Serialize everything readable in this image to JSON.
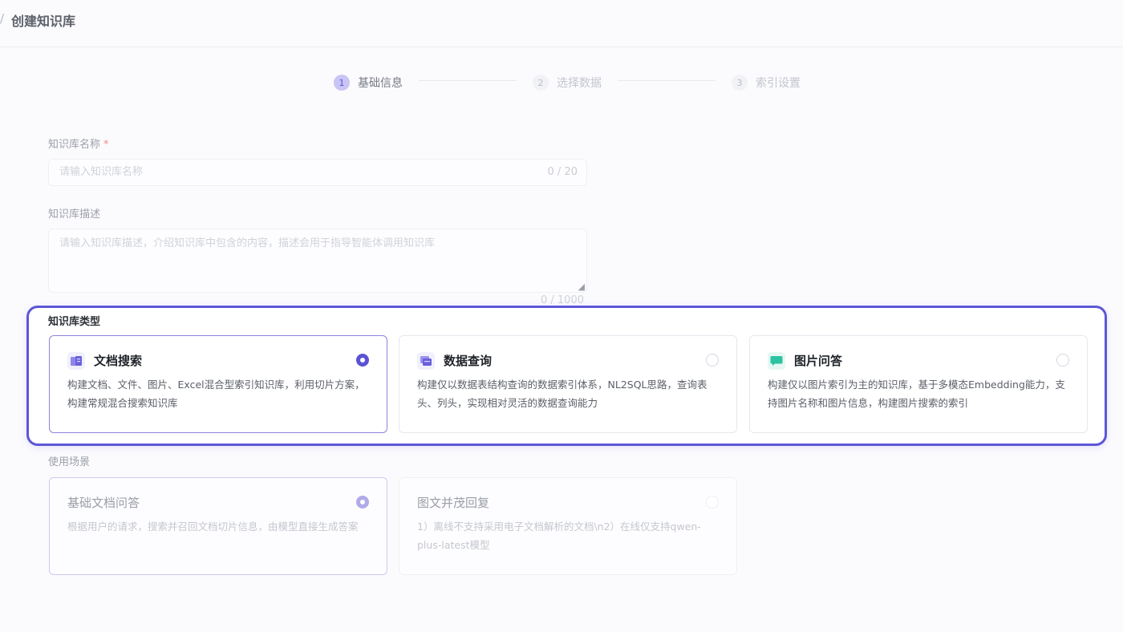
{
  "header": {
    "separator": "/",
    "title": "创建知识库"
  },
  "steps": [
    {
      "num": "1",
      "label": "基础信息",
      "status": "active"
    },
    {
      "num": "2",
      "label": "选择数据",
      "status": "pending"
    },
    {
      "num": "3",
      "label": "索引设置",
      "status": "pending"
    }
  ],
  "form": {
    "name": {
      "label": "知识库名称",
      "required_mark": "*",
      "placeholder": "请输入知识库名称",
      "value": "",
      "count": "0 / 20"
    },
    "desc": {
      "label": "知识库描述",
      "placeholder": "请输入知识库描述，介绍知识库中包含的内容，描述会用于指导智能体调用知识库",
      "value": "",
      "count": "0 / 1000"
    },
    "type": {
      "label": "知识库类型",
      "options": [
        {
          "title": "文档搜索",
          "desc": "构建文档、文件、图片、Excel混合型索引知识库，利用切片方案，构建常规混合搜索知识库",
          "selected": true,
          "icon": "document-book-icon"
        },
        {
          "title": "数据查询",
          "desc": "构建仅以数据表结构查询的数据索引体系，NL2SQL思路，查询表头、列头，实现相对灵活的数据查询能力",
          "selected": false,
          "icon": "data-table-icon"
        },
        {
          "title": "图片问答",
          "desc": "构建仅以图片索引为主的知识库，基于多模态Embedding能力，支持图片名称和图片信息，构建图片搜索的索引",
          "selected": false,
          "icon": "image-chat-icon"
        }
      ]
    },
    "scenario": {
      "label": "使用场景",
      "options": [
        {
          "title": "基础文档问答",
          "desc": "根据用户的请求，搜索并召回文档切片信息，由模型直接生成答案",
          "selected": true
        },
        {
          "title": "图文并茂回复",
          "desc": "1）离线不支持采用电子文档解析的文档\\n2）在线仅支持qwen-plus-latest模型",
          "selected": false
        }
      ]
    }
  },
  "colors": {
    "accent": "#5b52d6",
    "highlight_border": "#5d56d6",
    "step_active_bg": "#c9c5f4"
  }
}
